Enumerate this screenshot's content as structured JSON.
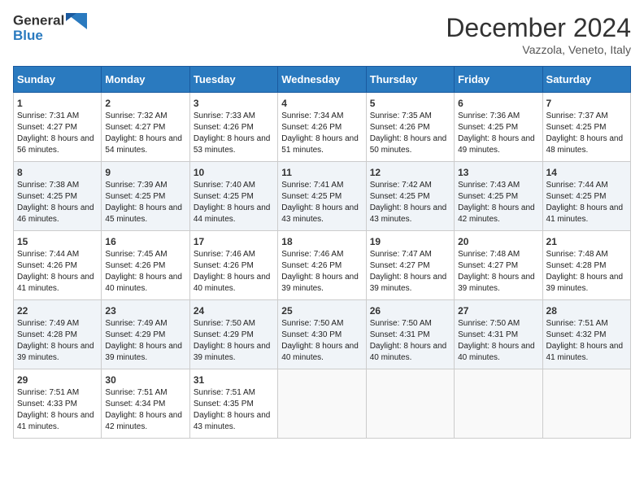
{
  "logo": {
    "line1": "General",
    "line2": "Blue"
  },
  "title": "December 2024",
  "subtitle": "Vazzola, Veneto, Italy",
  "days_header": [
    "Sunday",
    "Monday",
    "Tuesday",
    "Wednesday",
    "Thursday",
    "Friday",
    "Saturday"
  ],
  "weeks": [
    [
      {
        "day": "1",
        "sunrise": "Sunrise: 7:31 AM",
        "sunset": "Sunset: 4:27 PM",
        "daylight": "Daylight: 8 hours and 56 minutes."
      },
      {
        "day": "2",
        "sunrise": "Sunrise: 7:32 AM",
        "sunset": "Sunset: 4:27 PM",
        "daylight": "Daylight: 8 hours and 54 minutes."
      },
      {
        "day": "3",
        "sunrise": "Sunrise: 7:33 AM",
        "sunset": "Sunset: 4:26 PM",
        "daylight": "Daylight: 8 hours and 53 minutes."
      },
      {
        "day": "4",
        "sunrise": "Sunrise: 7:34 AM",
        "sunset": "Sunset: 4:26 PM",
        "daylight": "Daylight: 8 hours and 51 minutes."
      },
      {
        "day": "5",
        "sunrise": "Sunrise: 7:35 AM",
        "sunset": "Sunset: 4:26 PM",
        "daylight": "Daylight: 8 hours and 50 minutes."
      },
      {
        "day": "6",
        "sunrise": "Sunrise: 7:36 AM",
        "sunset": "Sunset: 4:25 PM",
        "daylight": "Daylight: 8 hours and 49 minutes."
      },
      {
        "day": "7",
        "sunrise": "Sunrise: 7:37 AM",
        "sunset": "Sunset: 4:25 PM",
        "daylight": "Daylight: 8 hours and 48 minutes."
      }
    ],
    [
      {
        "day": "8",
        "sunrise": "Sunrise: 7:38 AM",
        "sunset": "Sunset: 4:25 PM",
        "daylight": "Daylight: 8 hours and 46 minutes."
      },
      {
        "day": "9",
        "sunrise": "Sunrise: 7:39 AM",
        "sunset": "Sunset: 4:25 PM",
        "daylight": "Daylight: 8 hours and 45 minutes."
      },
      {
        "day": "10",
        "sunrise": "Sunrise: 7:40 AM",
        "sunset": "Sunset: 4:25 PM",
        "daylight": "Daylight: 8 hours and 44 minutes."
      },
      {
        "day": "11",
        "sunrise": "Sunrise: 7:41 AM",
        "sunset": "Sunset: 4:25 PM",
        "daylight": "Daylight: 8 hours and 43 minutes."
      },
      {
        "day": "12",
        "sunrise": "Sunrise: 7:42 AM",
        "sunset": "Sunset: 4:25 PM",
        "daylight": "Daylight: 8 hours and 43 minutes."
      },
      {
        "day": "13",
        "sunrise": "Sunrise: 7:43 AM",
        "sunset": "Sunset: 4:25 PM",
        "daylight": "Daylight: 8 hours and 42 minutes."
      },
      {
        "day": "14",
        "sunrise": "Sunrise: 7:44 AM",
        "sunset": "Sunset: 4:25 PM",
        "daylight": "Daylight: 8 hours and 41 minutes."
      }
    ],
    [
      {
        "day": "15",
        "sunrise": "Sunrise: 7:44 AM",
        "sunset": "Sunset: 4:26 PM",
        "daylight": "Daylight: 8 hours and 41 minutes."
      },
      {
        "day": "16",
        "sunrise": "Sunrise: 7:45 AM",
        "sunset": "Sunset: 4:26 PM",
        "daylight": "Daylight: 8 hours and 40 minutes."
      },
      {
        "day": "17",
        "sunrise": "Sunrise: 7:46 AM",
        "sunset": "Sunset: 4:26 PM",
        "daylight": "Daylight: 8 hours and 40 minutes."
      },
      {
        "day": "18",
        "sunrise": "Sunrise: 7:46 AM",
        "sunset": "Sunset: 4:26 PM",
        "daylight": "Daylight: 8 hours and 39 minutes."
      },
      {
        "day": "19",
        "sunrise": "Sunrise: 7:47 AM",
        "sunset": "Sunset: 4:27 PM",
        "daylight": "Daylight: 8 hours and 39 minutes."
      },
      {
        "day": "20",
        "sunrise": "Sunrise: 7:48 AM",
        "sunset": "Sunset: 4:27 PM",
        "daylight": "Daylight: 8 hours and 39 minutes."
      },
      {
        "day": "21",
        "sunrise": "Sunrise: 7:48 AM",
        "sunset": "Sunset: 4:28 PM",
        "daylight": "Daylight: 8 hours and 39 minutes."
      }
    ],
    [
      {
        "day": "22",
        "sunrise": "Sunrise: 7:49 AM",
        "sunset": "Sunset: 4:28 PM",
        "daylight": "Daylight: 8 hours and 39 minutes."
      },
      {
        "day": "23",
        "sunrise": "Sunrise: 7:49 AM",
        "sunset": "Sunset: 4:29 PM",
        "daylight": "Daylight: 8 hours and 39 minutes."
      },
      {
        "day": "24",
        "sunrise": "Sunrise: 7:50 AM",
        "sunset": "Sunset: 4:29 PM",
        "daylight": "Daylight: 8 hours and 39 minutes."
      },
      {
        "day": "25",
        "sunrise": "Sunrise: 7:50 AM",
        "sunset": "Sunset: 4:30 PM",
        "daylight": "Daylight: 8 hours and 40 minutes."
      },
      {
        "day": "26",
        "sunrise": "Sunrise: 7:50 AM",
        "sunset": "Sunset: 4:31 PM",
        "daylight": "Daylight: 8 hours and 40 minutes."
      },
      {
        "day": "27",
        "sunrise": "Sunrise: 7:50 AM",
        "sunset": "Sunset: 4:31 PM",
        "daylight": "Daylight: 8 hours and 40 minutes."
      },
      {
        "day": "28",
        "sunrise": "Sunrise: 7:51 AM",
        "sunset": "Sunset: 4:32 PM",
        "daylight": "Daylight: 8 hours and 41 minutes."
      }
    ],
    [
      {
        "day": "29",
        "sunrise": "Sunrise: 7:51 AM",
        "sunset": "Sunset: 4:33 PM",
        "daylight": "Daylight: 8 hours and 41 minutes."
      },
      {
        "day": "30",
        "sunrise": "Sunrise: 7:51 AM",
        "sunset": "Sunset: 4:34 PM",
        "daylight": "Daylight: 8 hours and 42 minutes."
      },
      {
        "day": "31",
        "sunrise": "Sunrise: 7:51 AM",
        "sunset": "Sunset: 4:35 PM",
        "daylight": "Daylight: 8 hours and 43 minutes."
      },
      null,
      null,
      null,
      null
    ]
  ]
}
